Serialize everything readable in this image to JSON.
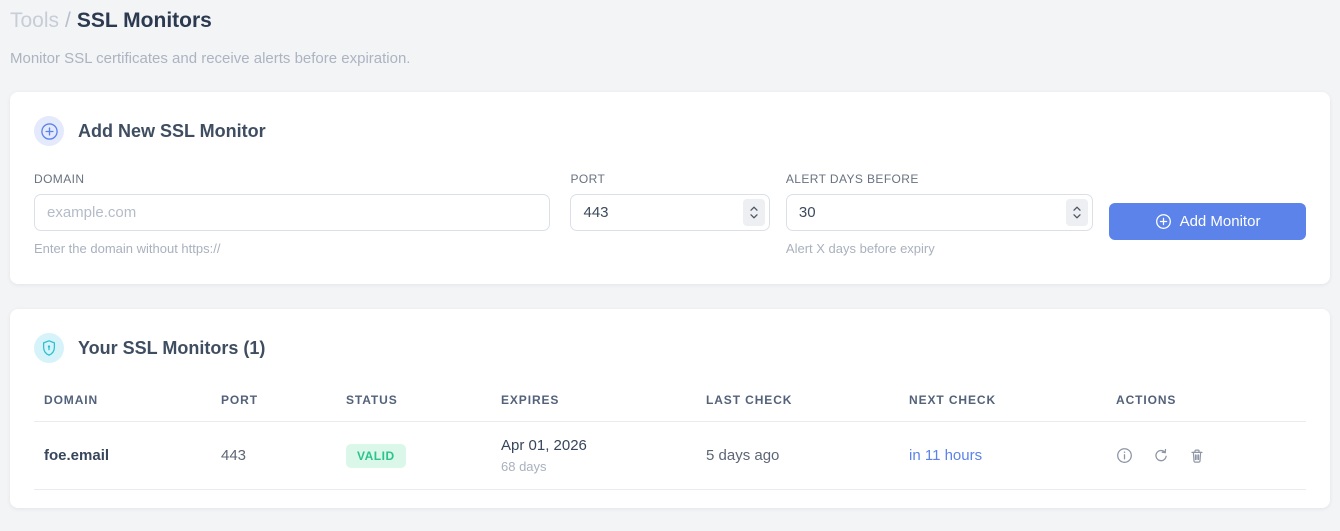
{
  "breadcrumb": {
    "section": "Tools",
    "separator": "/",
    "current": "SSL Monitors"
  },
  "subtitle": "Monitor SSL certificates and receive alerts before expiration.",
  "add_monitor_card": {
    "title": "Add New SSL Monitor",
    "header_icon": "plus-circle-icon",
    "fields": {
      "domain": {
        "label": "DOMAIN",
        "placeholder": "example.com",
        "value": "",
        "helper": "Enter the domain without https://"
      },
      "port": {
        "label": "PORT",
        "value": "443"
      },
      "alert_days": {
        "label": "ALERT DAYS BEFORE",
        "value": "30",
        "helper": "Alert X days before expiry"
      }
    },
    "submit_button": {
      "label": "Add Monitor",
      "icon": "plus-circle-icon"
    }
  },
  "monitors_card": {
    "title": "Your SSL Monitors (1)",
    "header_icon": "shield-lock-icon",
    "table": {
      "headers": [
        "DOMAIN",
        "PORT",
        "STATUS",
        "EXPIRES",
        "LAST CHECK",
        "NEXT CHECK",
        "ACTIONS"
      ],
      "rows": [
        {
          "domain": "foe.email",
          "port": "443",
          "status": "VALID",
          "expires_date": "Apr 01, 2026",
          "expires_in": "68 days",
          "last_check": "5 days ago",
          "next_check": "in 11 hours",
          "actions": [
            "info-icon",
            "refresh-icon",
            "trash-icon"
          ]
        }
      ]
    }
  },
  "colors": {
    "accent_blue": "#5b83ea",
    "accent_teal": "#2ac0d4",
    "valid_badge_bg": "#daf7e9",
    "valid_badge_text": "#2bc48c",
    "blue_badge_bg": "#e4eafc",
    "cyan_badge_bg": "#d6f3f9",
    "page_bg": "#f3f4f6"
  }
}
